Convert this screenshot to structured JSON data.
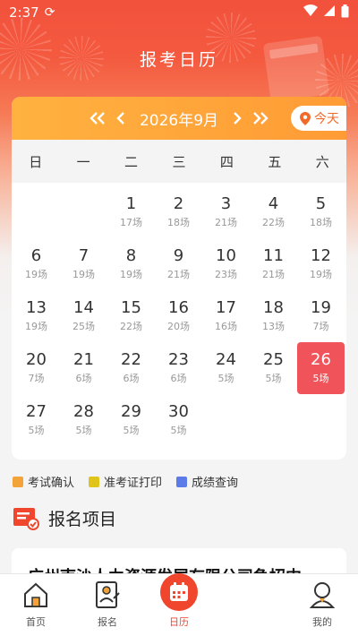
{
  "status_bar": {
    "time": "2:37"
  },
  "page": {
    "title": "报考日历"
  },
  "calendar": {
    "month_label": "2026年9月",
    "today_label": "今天",
    "weekdays": [
      "日",
      "一",
      "二",
      "三",
      "四",
      "五",
      "六"
    ],
    "days": [
      {
        "num": "",
        "count": ""
      },
      {
        "num": "",
        "count": ""
      },
      {
        "num": "1",
        "count": "17场"
      },
      {
        "num": "2",
        "count": "18场"
      },
      {
        "num": "3",
        "count": "21场"
      },
      {
        "num": "4",
        "count": "22场"
      },
      {
        "num": "5",
        "count": "18场"
      },
      {
        "num": "6",
        "count": "19场"
      },
      {
        "num": "7",
        "count": "19场"
      },
      {
        "num": "8",
        "count": "19场"
      },
      {
        "num": "9",
        "count": "21场"
      },
      {
        "num": "10",
        "count": "23场"
      },
      {
        "num": "11",
        "count": "21场"
      },
      {
        "num": "12",
        "count": "19场"
      },
      {
        "num": "13",
        "count": "19场"
      },
      {
        "num": "14",
        "count": "25场"
      },
      {
        "num": "15",
        "count": "22场"
      },
      {
        "num": "16",
        "count": "20场"
      },
      {
        "num": "17",
        "count": "16场"
      },
      {
        "num": "18",
        "count": "13场"
      },
      {
        "num": "19",
        "count": "7场"
      },
      {
        "num": "20",
        "count": "7场"
      },
      {
        "num": "21",
        "count": "6场"
      },
      {
        "num": "22",
        "count": "6场"
      },
      {
        "num": "23",
        "count": "6场"
      },
      {
        "num": "24",
        "count": "5场"
      },
      {
        "num": "25",
        "count": "5场"
      },
      {
        "num": "26",
        "count": "5场",
        "selected": true
      },
      {
        "num": "27",
        "count": "5场"
      },
      {
        "num": "28",
        "count": "5场"
      },
      {
        "num": "29",
        "count": "5场"
      },
      {
        "num": "30",
        "count": "5场"
      }
    ]
  },
  "legend": [
    {
      "label": "考试确认",
      "color": "#f2a33a"
    },
    {
      "label": "准考证打印",
      "color": "#e0c419"
    },
    {
      "label": "成绩查询",
      "color": "#5b7be8"
    }
  ],
  "section": {
    "title": "报名项目"
  },
  "project": {
    "title": "广州南沙人力资源发展有限公司急招中"
  },
  "tabs": [
    {
      "label": "首页",
      "icon": "home-icon"
    },
    {
      "label": "报名",
      "icon": "signup-icon"
    },
    {
      "label": "日历",
      "icon": "calendar-icon",
      "active": true
    },
    {
      "label": "我的",
      "icon": "profile-icon"
    }
  ],
  "colors": {
    "accent": "#f0462e",
    "selected_day": "#f0545a",
    "month_bar": "#ffa63a"
  }
}
